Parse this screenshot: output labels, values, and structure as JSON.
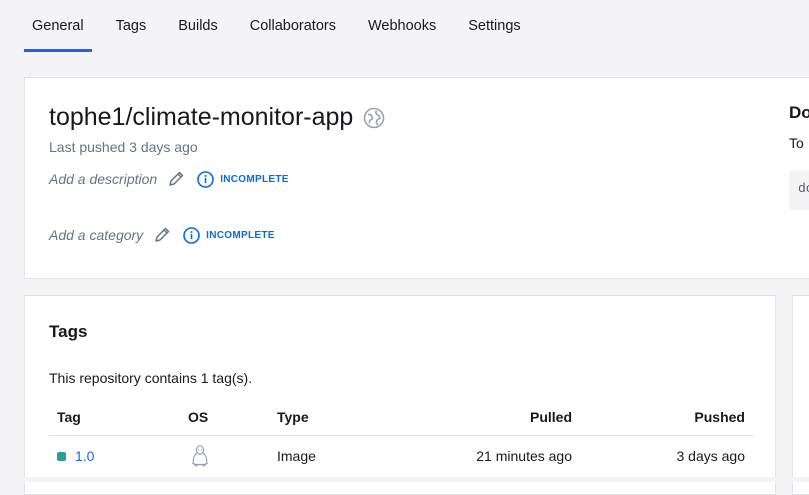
{
  "tabs": [
    {
      "label": "General",
      "active": true
    },
    {
      "label": "Tags"
    },
    {
      "label": "Builds"
    },
    {
      "label": "Collaborators"
    },
    {
      "label": "Webhooks"
    },
    {
      "label": "Settings"
    }
  ],
  "repo": {
    "name": "tophe1/climate-monitor-app",
    "visibility_icon": "globe-icon",
    "last_pushed": "Last pushed 3 days ago",
    "description_placeholder": "Add a description",
    "description_status": "INCOMPLETE",
    "category_placeholder": "Add a category",
    "category_status": "INCOMPLETE"
  },
  "side_panel": {
    "title": "Do",
    "text": "To",
    "code": "do"
  },
  "tags_section": {
    "title": "Tags",
    "summary": "This repository contains 1 tag(s).",
    "columns": {
      "tag": "Tag",
      "os": "OS",
      "type": "Type",
      "pulled": "Pulled",
      "pushed": "Pushed"
    },
    "rows": [
      {
        "tag": "1.0",
        "os_icon": "linux-icon",
        "type": "Image",
        "pulled": "21 minutes ago",
        "pushed": "3 days ago",
        "status_color": "#2e9e8d"
      }
    ]
  },
  "colors": {
    "accent": "#1d63ed",
    "status_badge": "#086dd7",
    "muted_text": "#677285"
  }
}
